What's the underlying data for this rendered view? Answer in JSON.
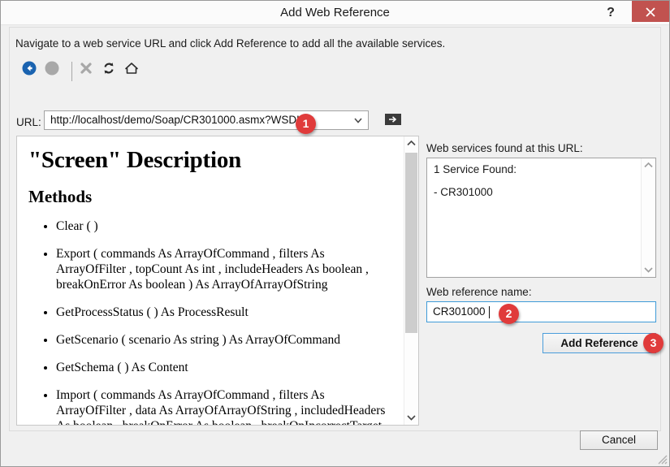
{
  "window": {
    "title": "Add Web Reference",
    "help_icon": "question-mark-icon",
    "close_icon": "close-x-icon",
    "close_color": "#c1524f"
  },
  "instruction": "Navigate to a web service URL and click Add Reference to add all the available services.",
  "toolbar": {
    "items": [
      {
        "name": "back-button",
        "icon": "back-arrow-circle-icon",
        "enabled": true
      },
      {
        "name": "forward-button",
        "icon": "forward-arrow-circle-icon",
        "enabled": false
      },
      {
        "name": "stop-button",
        "icon": "stop-x-icon",
        "enabled": false
      },
      {
        "name": "refresh-button",
        "icon": "refresh-icon",
        "enabled": true
      },
      {
        "name": "home-button",
        "icon": "home-icon",
        "enabled": true
      }
    ]
  },
  "url_row": {
    "label": "URL:",
    "value": "http://localhost/demo/Soap/CR301000.asmx?WSDL",
    "dropdown_icon": "chevron-down-icon",
    "go_icon": "go-arrow-icon"
  },
  "document": {
    "title": "\"Screen\" Description",
    "subtitle": "Methods",
    "methods": [
      "Clear ( )",
      "Export ( commands As ArrayOfCommand ,  filters As ArrayOfFilter ,  topCount As int ,  includeHeaders As boolean ,  breakOnError As boolean ) As ArrayOfArrayOfString",
      "GetProcessStatus ( ) As ProcessResult",
      "GetScenario ( scenario As string ) As ArrayOfCommand",
      "GetSchema ( ) As Content",
      "Import ( commands As ArrayOfCommand ,  filters As ArrayOfFilter ,  data As ArrayOfArrayOfString ,  includedHeaders As boolean ,  breakOnError As boolean ,  breakOnIncorrectTarget As boolean ) As ArrayOfImportResult"
    ]
  },
  "services": {
    "label": "Web services found at this URL:",
    "found_text": "1 Service Found:",
    "items": [
      "- CR301000"
    ]
  },
  "reference_name": {
    "label": "Web reference name:",
    "value": "CR301000"
  },
  "buttons": {
    "add_reference": "Add Reference",
    "cancel": "Cancel"
  },
  "annotations": [
    {
      "number": "1",
      "target": "url-field"
    },
    {
      "number": "2",
      "target": "web-reference-name-field"
    },
    {
      "number": "3",
      "target": "add-reference-button"
    }
  ]
}
